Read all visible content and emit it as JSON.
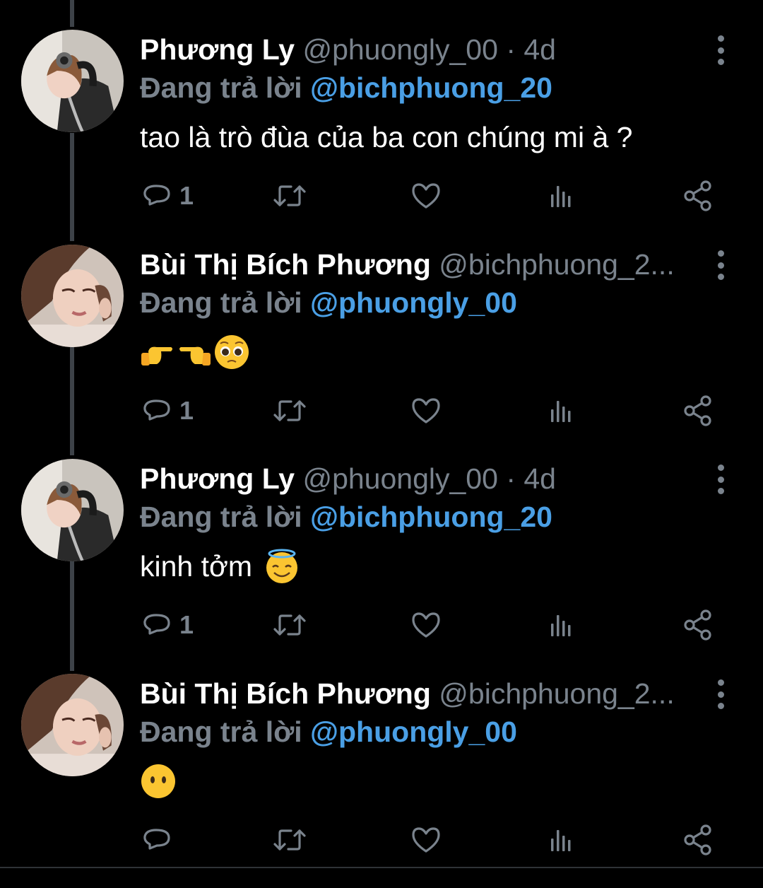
{
  "colors": {
    "background": "#000000",
    "name": "#ffffff",
    "muted": "#7a838d",
    "mention": "#4a9fe5",
    "thread_line": "#3d4248"
  },
  "reply_prefix": "Đang trả lời",
  "tweets": [
    {
      "name": "Phương Ly",
      "handle": "@phuongly_00",
      "separator": "·",
      "time": "4d",
      "reply_to": "@bichphuong_20",
      "text": "tao là trò đùa của ba con chúng mi à ?",
      "emojis": [],
      "reply_count": "1",
      "avatar": "avatar-phuong-ly"
    },
    {
      "name": "Bùi Thị Bích Phương",
      "handle": "@bichphuong_2...",
      "separator": "",
      "time": "",
      "reply_to": "@phuongly_00",
      "text": "",
      "emojis": [
        "pointing-right-emoji",
        "pointing-left-emoji",
        "pleading-face-emoji"
      ],
      "reply_count": "1",
      "avatar": "avatar-bich-phuong"
    },
    {
      "name": "Phương Ly",
      "handle": "@phuongly_00",
      "separator": "·",
      "time": "4d",
      "reply_to": "@bichphuong_20",
      "text": "kinh tởm",
      "emojis": [
        "halo-face-emoji"
      ],
      "reply_count": "1",
      "avatar": "avatar-phuong-ly"
    },
    {
      "name": "Bùi Thị Bích Phương",
      "handle": "@bichphuong_2...",
      "separator": "",
      "time": "",
      "reply_to": "@phuongly_00",
      "text": "",
      "emojis": [
        "no-mouth-face-emoji"
      ],
      "reply_count": "",
      "avatar": "avatar-bich-phuong"
    }
  ],
  "action_icons": [
    "reply-icon",
    "retweet-icon",
    "like-icon",
    "analytics-icon",
    "share-icon"
  ]
}
